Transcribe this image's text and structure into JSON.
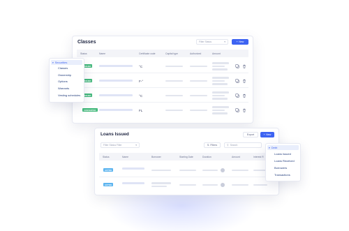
{
  "classes": {
    "title": "Classes",
    "filter_placeholder": "Filter Status",
    "new_label": "New",
    "columns": [
      "Status",
      "Name",
      "Certificate code",
      "Capital type",
      "Authorized",
      "Amount"
    ],
    "rows": [
      {
        "status": "ISSUED",
        "code": "°C"
      },
      {
        "status": "ISSUED",
        "code": "F-°"
      },
      {
        "status": "ISSUED",
        "code": "°C"
      },
      {
        "status": "CONVERTED",
        "code": "FL"
      }
    ]
  },
  "securities_menu": {
    "header": "Securities",
    "items": [
      "Classes",
      "Ownership",
      "Options",
      "Warrants",
      "Vesting schedules"
    ]
  },
  "loans": {
    "title": "Loans Issued",
    "export_label": "Export",
    "new_label": "New",
    "filters_label": "Filters",
    "search_placeholder": "Search",
    "filter_select": "Filter Status Filter",
    "columns": [
      "Status",
      "Name",
      "Borrower",
      "Starting Date",
      "Duration",
      "Amount",
      "Interest R"
    ],
    "rows": [
      {
        "status": "ACTIVE"
      },
      {
        "status": "ACTIVE"
      }
    ]
  },
  "debt_menu": {
    "header": "Debt",
    "items": [
      "Loans Issued",
      "Loans Received",
      "Borrowers",
      "Transactions"
    ]
  },
  "colors": {
    "accent": "#3d63f2",
    "issued": "#43b97b",
    "active": "#5cb4ef"
  },
  "icons": [
    "chevron-down-icon",
    "plus-icon",
    "copy-icon",
    "trash-icon",
    "filter-icon",
    "search-icon"
  ]
}
